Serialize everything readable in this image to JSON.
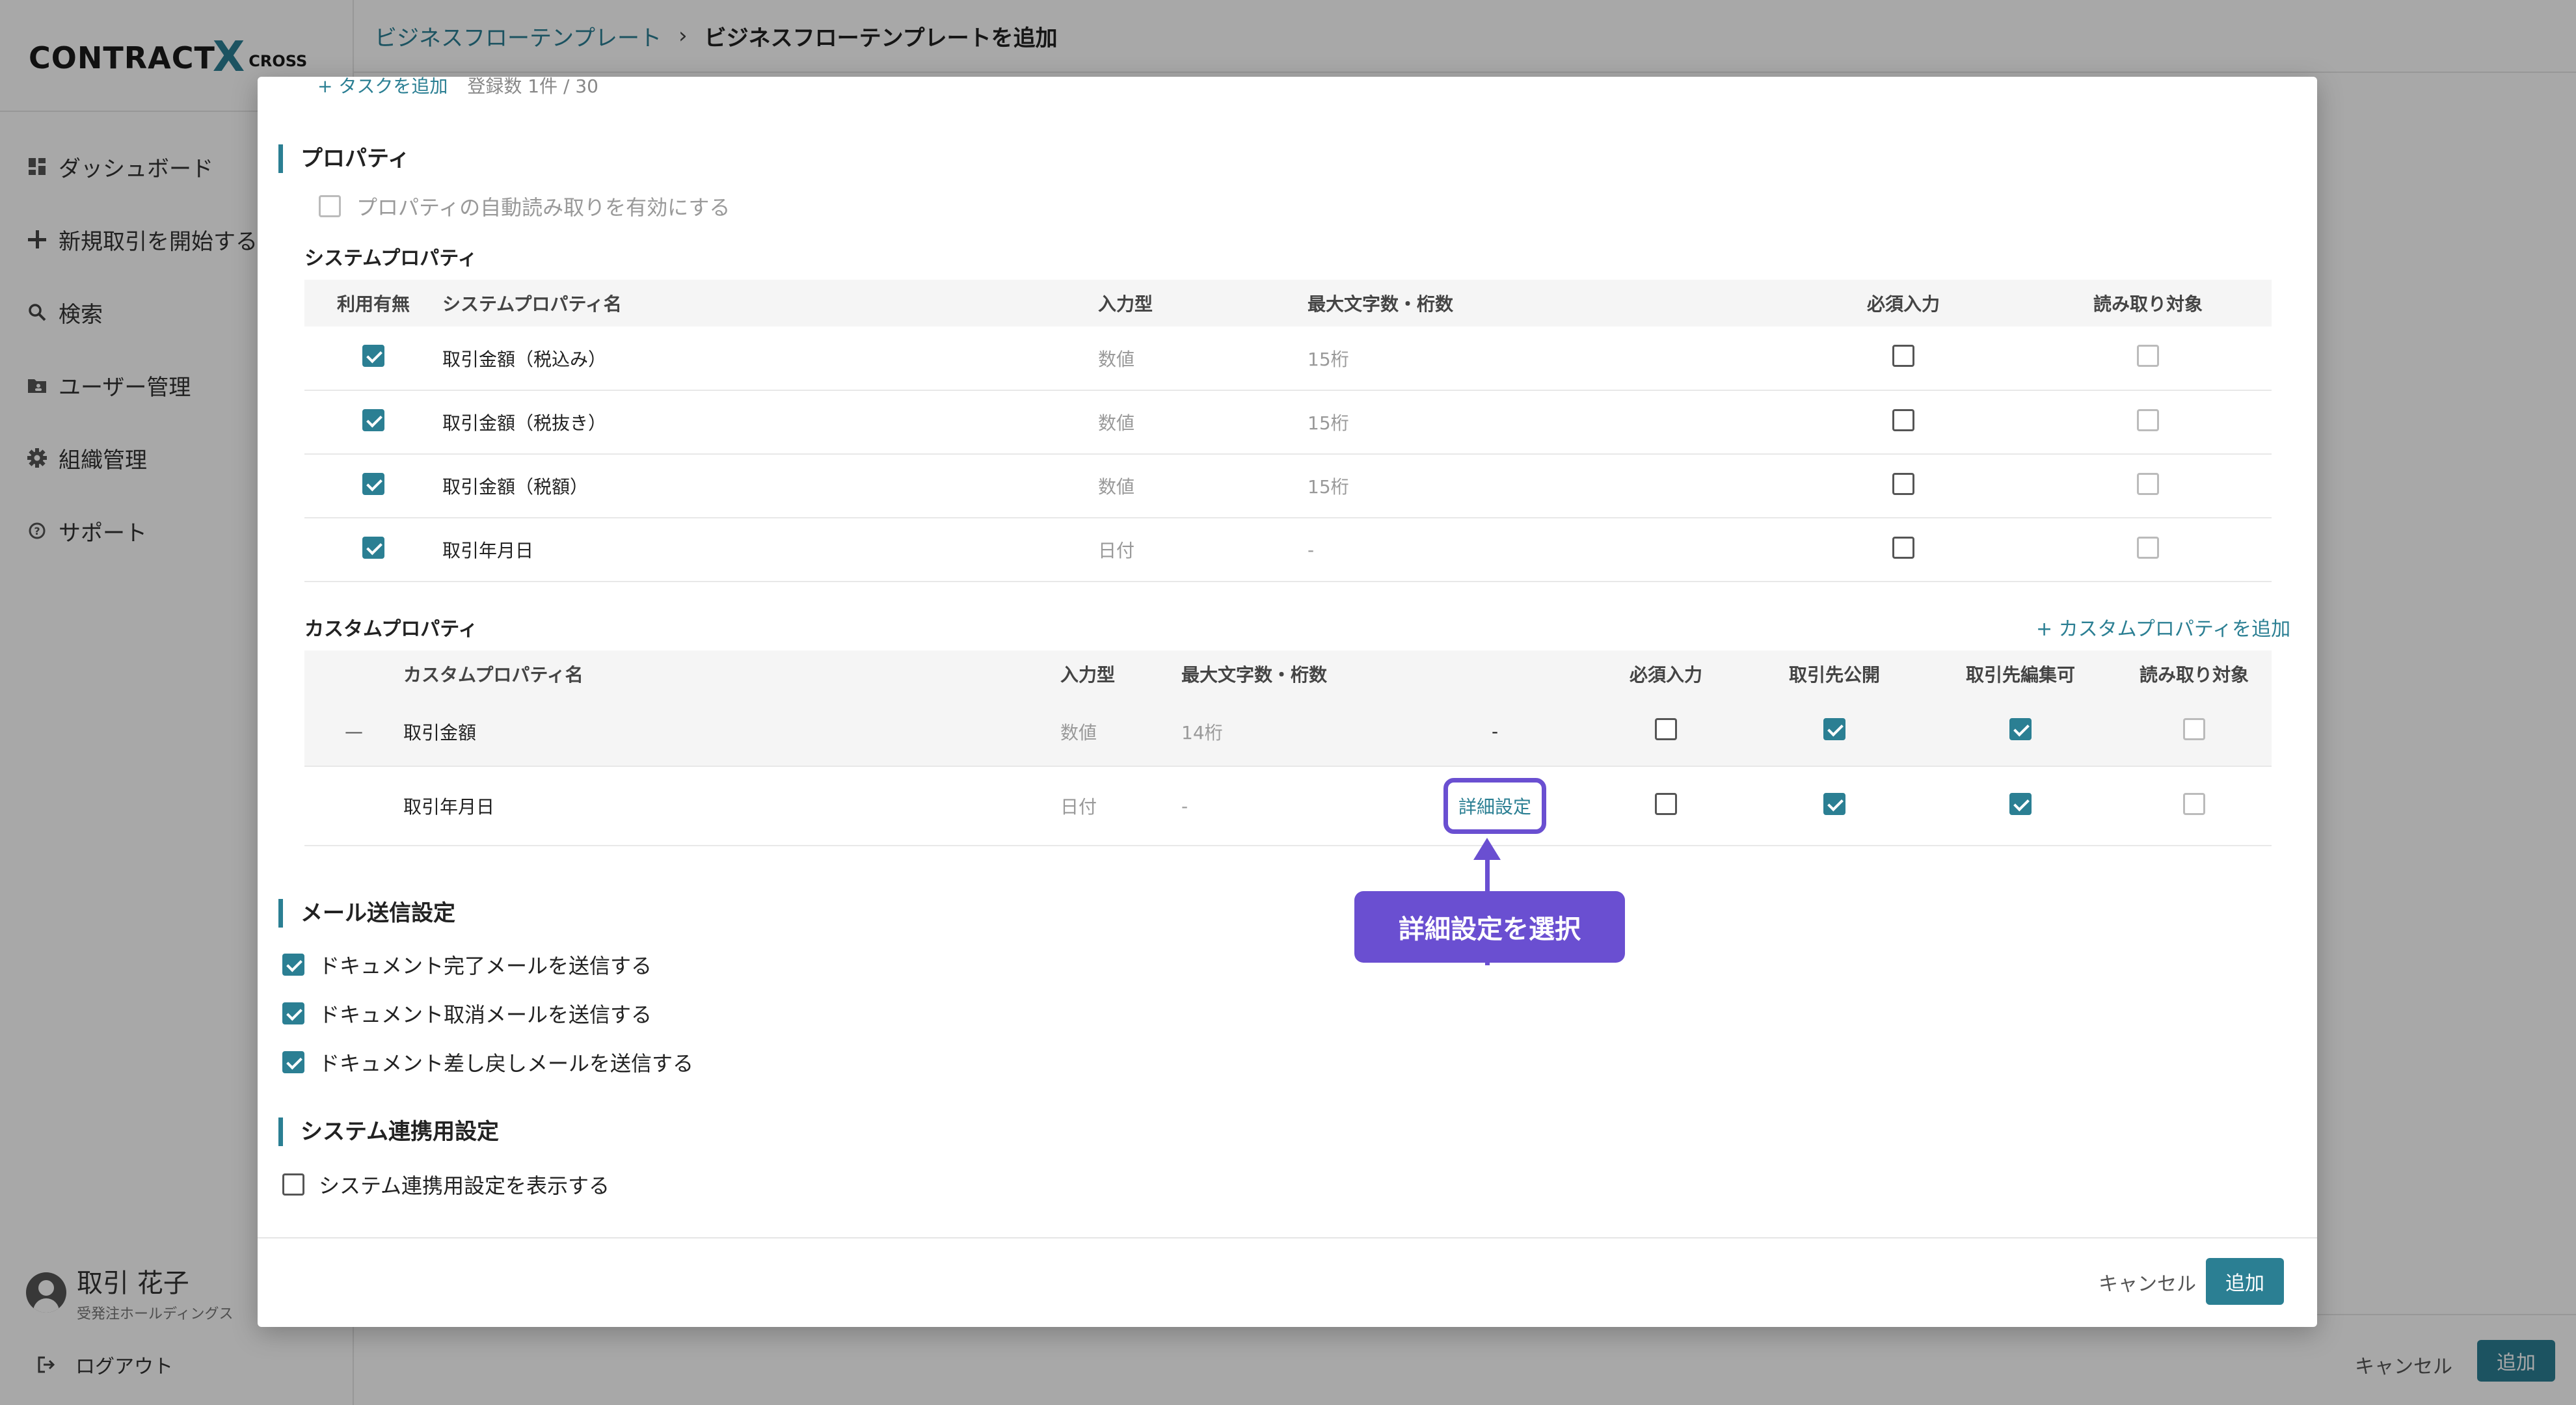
{
  "app": {
    "logo_main": "CONTRACT",
    "logo_x": "X",
    "logo_sub": "CROSS"
  },
  "breadcrumb": {
    "parent": "ビジネスフローテンプレート",
    "separator": "›",
    "current": "ビジネスフローテンプレートを追加"
  },
  "sidebar": {
    "items": [
      {
        "label": "ダッシュボード",
        "icon": "dashboard-icon"
      },
      {
        "label": "新規取引を開始する",
        "icon": "plus-icon"
      },
      {
        "label": "検索",
        "icon": "search-icon"
      },
      {
        "label": "ユーザー管理",
        "icon": "folder-user-icon"
      },
      {
        "label": "組織管理",
        "icon": "gear-icon"
      },
      {
        "label": "サポート",
        "icon": "help-icon"
      }
    ],
    "user": {
      "name": "取引 花子",
      "org": "受発注ホールディングス"
    },
    "logout": "ログアウト"
  },
  "page_footer": {
    "cancel": "キャンセル",
    "add": "追加"
  },
  "modal": {
    "task_add_link": "+ タスクを追加",
    "task_count": "登録数 1件 / 30",
    "properties_title": "プロパティ",
    "auto_read_label": "プロパティの自動読み取りを有効にする",
    "system_props": {
      "title": "システムプロパティ",
      "headers": [
        "利用有無",
        "システムプロパティ名",
        "入力型",
        "最大文字数・桁数",
        "必須入力",
        "読み取り対象"
      ],
      "rows": [
        {
          "enabled": true,
          "name": "取引金額（税込み）",
          "type": "数値",
          "max": "15桁",
          "required": false,
          "read": false
        },
        {
          "enabled": true,
          "name": "取引金額（税抜き）",
          "type": "数値",
          "max": "15桁",
          "required": false,
          "read": false
        },
        {
          "enabled": true,
          "name": "取引金額（税額）",
          "type": "数値",
          "max": "15桁",
          "required": false,
          "read": false
        },
        {
          "enabled": true,
          "name": "取引年月日",
          "type": "日付",
          "max": "-",
          "required": false,
          "read": false
        }
      ]
    },
    "custom_props": {
      "title": "カスタムプロパティ",
      "add_link": "+ カスタムプロパティを追加",
      "headers": [
        "カスタムプロパティ名",
        "入力型",
        "最大文字数・桁数",
        "必須入力",
        "取引先公開",
        "取引先編集可",
        "読み取り対象"
      ],
      "rows": [
        {
          "handle": "—",
          "name": "取引金額",
          "type": "数値",
          "max": "14桁",
          "extra": "-",
          "required": false,
          "public": true,
          "editable": true,
          "read": false
        },
        {
          "handle": "",
          "name": "取引年月日",
          "type": "日付",
          "max": "-",
          "extra": "詳細設定",
          "required": false,
          "public": true,
          "editable": true,
          "read": false
        }
      ]
    },
    "callout": "詳細設定を選択",
    "mail": {
      "title": "メール送信設定",
      "options": [
        {
          "label": "ドキュメント完了メールを送信する",
          "checked": true
        },
        {
          "label": "ドキュメント取消メールを送信する",
          "checked": true
        },
        {
          "label": "ドキュメント差し戻しメールを送信する",
          "checked": true
        }
      ]
    },
    "integration": {
      "title": "システム連携用設定",
      "option": {
        "label": "システム連携用設定を表示する",
        "checked": false
      }
    },
    "footer": {
      "cancel": "キャンセル",
      "add": "追加"
    }
  },
  "colors": {
    "accent": "#2b7f93",
    "callout": "#6a4fd1"
  }
}
